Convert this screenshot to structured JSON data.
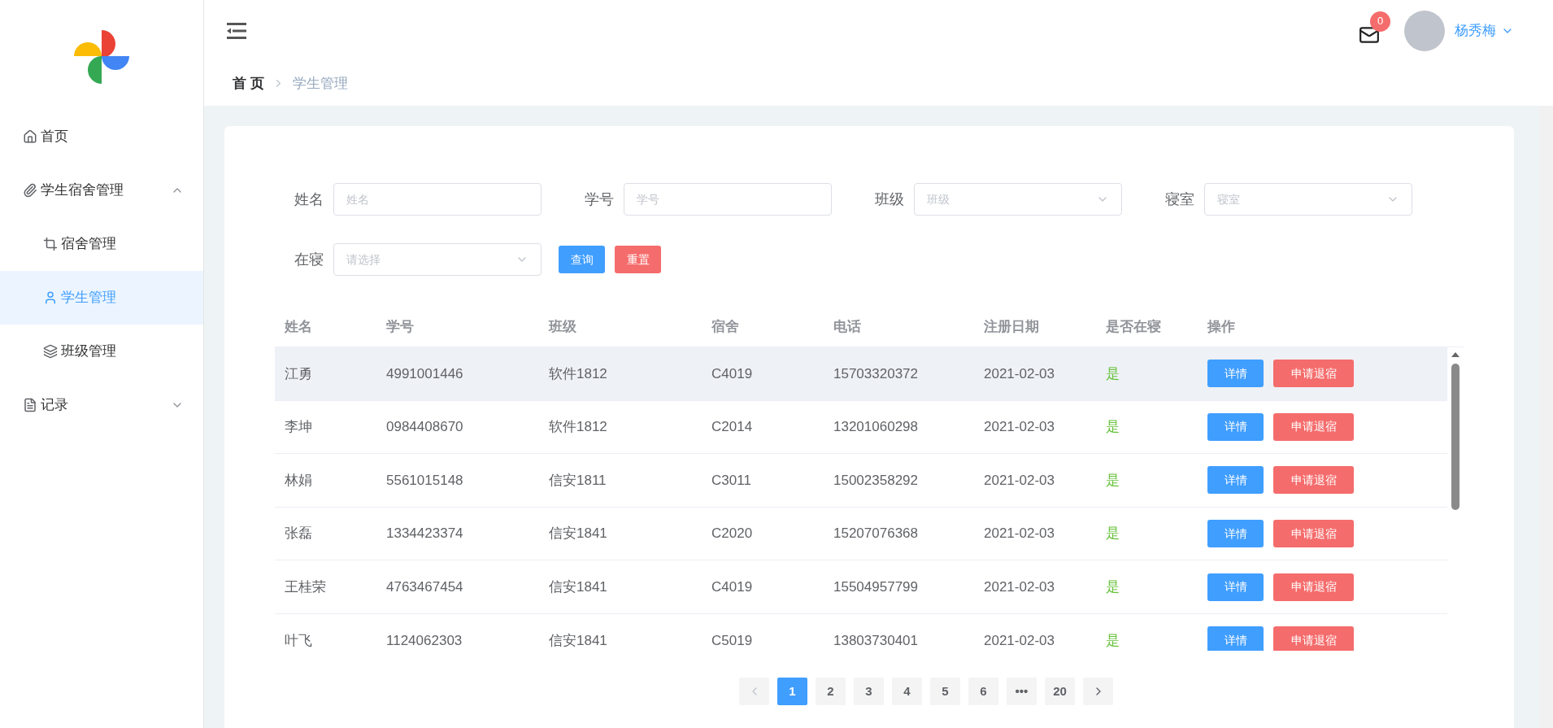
{
  "header": {
    "notification_count": "0",
    "user_name": "杨秀梅"
  },
  "breadcrumb": [
    {
      "label": "首 页",
      "current": false
    },
    {
      "label": "学生管理",
      "current": true
    }
  ],
  "sidebar": {
    "items": [
      {
        "label": "首页",
        "kind": "home",
        "selected": false
      },
      {
        "label": "学生宿舍管理",
        "kind": "clip",
        "selected": false,
        "expanded": true,
        "children": [
          {
            "label": "宿舍管理",
            "kind": "crop",
            "selected": false
          },
          {
            "label": "学生管理",
            "kind": "user",
            "selected": true
          },
          {
            "label": "班级管理",
            "kind": "layers",
            "selected": false
          }
        ]
      },
      {
        "label": "记录",
        "kind": "doc",
        "selected": false,
        "expanded": false
      }
    ]
  },
  "filters": [
    {
      "label": "姓名",
      "kind": "input",
      "placeholder": "姓名"
    },
    {
      "label": "学号",
      "kind": "input",
      "placeholder": "学号"
    },
    {
      "label": "班级",
      "kind": "select",
      "placeholder": "班级"
    },
    {
      "label": "寝室",
      "kind": "select",
      "placeholder": "寝室"
    },
    {
      "label": "在寝",
      "kind": "select",
      "placeholder": "请选择"
    }
  ],
  "filter_buttons": [
    {
      "label": "查询",
      "kind": "primary"
    },
    {
      "label": "重置",
      "kind": "danger"
    }
  ],
  "table": {
    "columns": [
      "姓名",
      "学号",
      "班级",
      "宿舍",
      "电话",
      "注册日期",
      "是否在寝",
      "操作"
    ],
    "rows": [
      {
        "cells": [
          "江勇",
          "4991001446",
          "软件1812",
          "C4019",
          "15703320372",
          "2021-02-03",
          "是"
        ],
        "actions": [
          "详情",
          "申请退宿"
        ],
        "selected": true
      },
      {
        "cells": [
          "李坤",
          "0984408670",
          "软件1812",
          "C2014",
          "13201060298",
          "2021-02-03",
          "是"
        ],
        "actions": [
          "详情",
          "申请退宿"
        ],
        "selected": false
      },
      {
        "cells": [
          "林娟",
          "5561015148",
          "信安1811",
          "C3011",
          "15002358292",
          "2021-02-03",
          "是"
        ],
        "actions": [
          "详情",
          "申请退宿"
        ],
        "selected": false
      },
      {
        "cells": [
          "张磊",
          "1334423374",
          "信安1841",
          "C2020",
          "15207076368",
          "2021-02-03",
          "是"
        ],
        "actions": [
          "详情",
          "申请退宿"
        ],
        "selected": false
      },
      {
        "cells": [
          "王桂荣",
          "4763467454",
          "信安1841",
          "C4019",
          "15504957799",
          "2021-02-03",
          "是"
        ],
        "actions": [
          "详情",
          "申请退宿"
        ],
        "selected": false
      },
      {
        "cells": [
          "叶飞",
          "1124062303",
          "信安1841",
          "C5019",
          "13803730401",
          "2021-02-03",
          "是"
        ],
        "actions": [
          "详情",
          "申请退宿"
        ],
        "selected": false
      }
    ]
  },
  "pagination": {
    "prev_disabled": true,
    "pages": [
      {
        "label": "1",
        "selected": true
      },
      {
        "label": "2",
        "selected": false
      },
      {
        "label": "3",
        "selected": false
      },
      {
        "label": "4",
        "selected": false
      },
      {
        "label": "5",
        "selected": false
      },
      {
        "label": "6",
        "selected": false
      },
      {
        "label": "•••",
        "selected": false
      },
      {
        "label": "20",
        "selected": false
      }
    ]
  }
}
